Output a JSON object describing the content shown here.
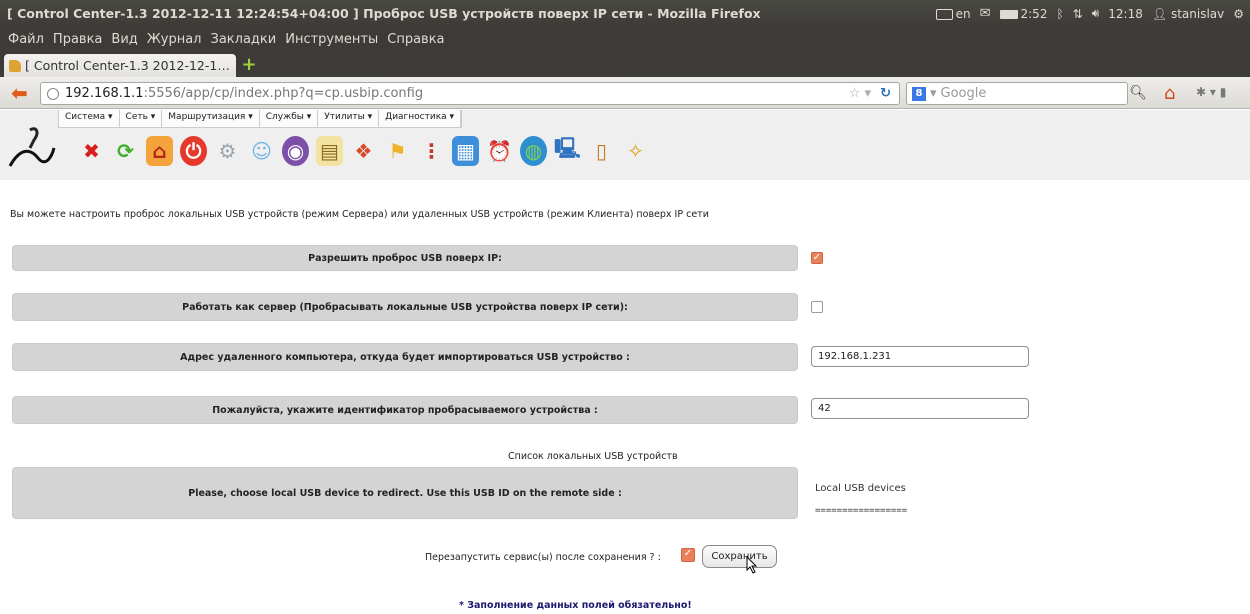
{
  "window": {
    "title": "[ Control Center-1.3 2012-12-11 12:24:54+04:00 ] Проброс USB устройств поверх IP сети - Mozilla Firefox"
  },
  "tray": {
    "lang": "en",
    "battery": "2:52",
    "time": "12:18",
    "user": "stanislav"
  },
  "menubar": {
    "items": [
      "Файл",
      "Правка",
      "Вид",
      "Журнал",
      "Закладки",
      "Инструменты",
      "Справка"
    ]
  },
  "tabs": [
    {
      "label": "[ Control Center-1.3 2012-12-1…"
    }
  ],
  "navbar": {
    "url_host": "192.168.1.1",
    "url_rest": ":5556/app/cp/index.php?q=cp.usbip.config",
    "search_placeholder": "Google"
  },
  "appmenu": {
    "items": [
      "Система ▾",
      "Сеть ▾",
      "Маршрутизация ▾",
      "Службы ▾",
      "Утилиты ▾",
      "Диагностика ▾"
    ]
  },
  "toolbar_icons": [
    "close-icon",
    "refresh-icon",
    "home-icon",
    "power-icon",
    "settings-icon",
    "users-icon",
    "disk-icon",
    "document-icon",
    "network-icon",
    "flag-icon",
    "traffic-light-icon",
    "calendar-icon",
    "alarm-clock-icon",
    "globe-icon",
    "computer-icon",
    "trash-icon",
    "magic-wand-icon"
  ],
  "form": {
    "intro": "Вы можете настроить проброс локальных USB устройств (режим Сервера) или удаленных USB устройств (режим Клиента) поверх IP сети",
    "enable_label": "Разрешить проброс USB поверх IP:",
    "enable_checked": true,
    "server_label": "Работать как сервер (Пробрасывать локальные USB устройства поверх IP сети):",
    "server_checked": false,
    "remote_label": "Адрес удаленного компьютера, откуда будет импортироваться USB устройство :",
    "remote_value": "192.168.1.231",
    "device_label": "Пожалуйста, укажите идентификатор пробрасываемого устройства :",
    "device_value": "42",
    "usb_list_caption": "Список локальных USB устройств",
    "choose_label": "Please, choose local USB device to redirect. Use this USB ID on the remote side :",
    "local_devices_title": "Local USB devices",
    "local_devices_sep": "=================",
    "restart_label": "Перезапустить сервис(ы) после сохранения ? :",
    "restart_checked": true,
    "save_label": "Сохранить",
    "required_note": "* Заполнение данных полей обязательно!"
  }
}
